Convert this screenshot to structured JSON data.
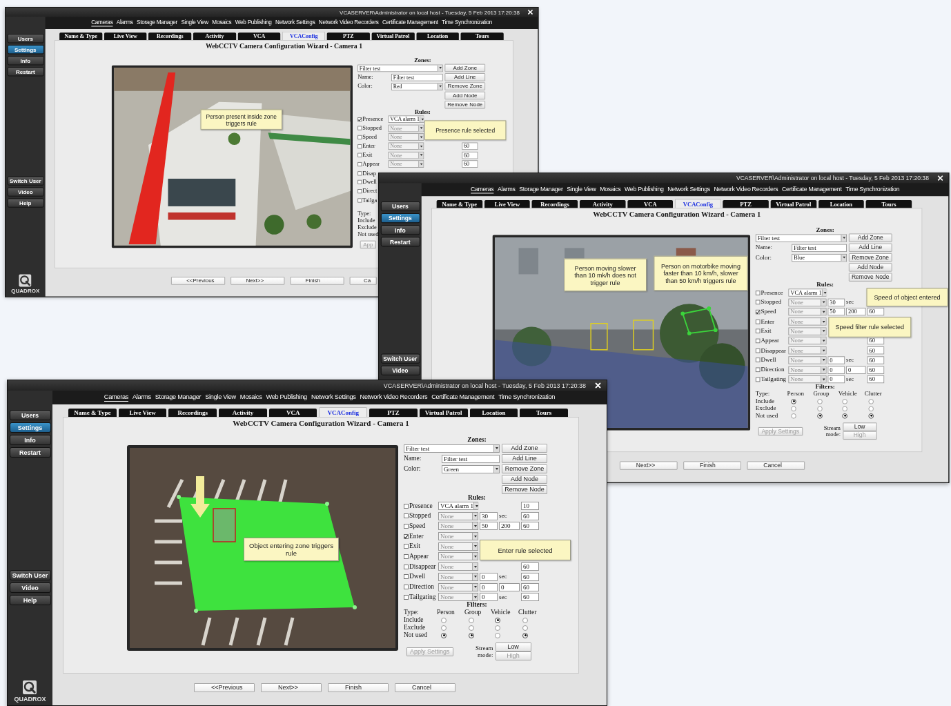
{
  "windows": [
    {
      "title": "VCASERVER\\Administrator on local host  -  Tuesday, 5 Feb 2013 17:20:38",
      "menu": [
        {
          "label": "Cameras",
          "selected": true
        },
        {
          "label": "Alarms",
          "selected": false
        },
        {
          "label": "Storage Manager",
          "selected": false
        },
        {
          "label": "Single View",
          "selected": false
        },
        {
          "label": "Mosaics",
          "selected": false
        },
        {
          "label": "Web Publishing",
          "selected": false
        },
        {
          "label": "Network Settings",
          "selected": false
        },
        {
          "label": "Network Video Recorders",
          "selected": false
        },
        {
          "label": "Certificate Management",
          "selected": false
        },
        {
          "label": "Time Synchronization",
          "selected": false
        }
      ],
      "sidebar": [
        {
          "label": "Users",
          "selected": false
        },
        {
          "label": "Settings",
          "selected": true
        },
        {
          "label": "Info",
          "selected": false
        },
        {
          "label": "Restart",
          "selected": false
        }
      ],
      "sidebar_actions": [
        "Switch User",
        "Video",
        "Help"
      ],
      "logo": "QUADROX",
      "tabs": [
        {
          "label": "Name & Type",
          "selected": false
        },
        {
          "label": "Live View",
          "selected": false
        },
        {
          "label": "Recordings",
          "selected": false
        },
        {
          "label": "Activity",
          "selected": false
        },
        {
          "label": "VCA",
          "selected": false
        },
        {
          "label": "VCAConfig",
          "selected": true
        },
        {
          "label": "PTZ",
          "selected": false
        },
        {
          "label": "Virtual Patrol",
          "selected": false
        },
        {
          "label": "Location",
          "selected": false
        },
        {
          "label": "Tours",
          "selected": false
        }
      ],
      "heading": "WebCCTV Camera Configuration Wizard - Camera 1",
      "zones": {
        "heading": "Zones:",
        "zone": "Filter test",
        "name_label": "Name:",
        "name": "Filter test",
        "color_label": "Color:",
        "color_name": "Red",
        "buttons": [
          "Add Zone",
          "Add Line",
          "Remove Zone",
          "Add Node",
          "Remove Node"
        ]
      },
      "rules": {
        "heading": "Rules:",
        "rows": [
          {
            "label": "Presence",
            "checked": true,
            "select": "VCA alarm 1",
            "select_disabled": false
          },
          {
            "label": "Stopped",
            "checked": false,
            "select": "None",
            "select_disabled": true
          },
          {
            "label": "Speed",
            "checked": false,
            "select": "None",
            "select_disabled": true
          },
          {
            "label": "Enter",
            "checked": false,
            "select": "None",
            "select_disabled": true,
            "field_3": "60"
          },
          {
            "label": "Exit",
            "checked": false,
            "select": "None",
            "select_disabled": true,
            "field_3": "60"
          },
          {
            "label": "Appear",
            "checked": false,
            "select": "None",
            "select_disabled": true,
            "field_3": "60"
          },
          {
            "label": "Disap",
            "checked": false
          },
          {
            "label": "Dwell",
            "checked": false
          },
          {
            "label": "Direct",
            "checked": false
          },
          {
            "label": "Tailga",
            "checked": false
          }
        ]
      },
      "filters": {
        "columns": [
          "Type:"
        ],
        "rows": [
          {
            "label": "Include"
          },
          {
            "label": "Exclude"
          },
          {
            "label": "Not used"
          }
        ]
      },
      "apply": {
        "label": "App",
        "disabled": true
      },
      "nav": [
        "<<Previous",
        "Next>>",
        "Finish",
        "Ca"
      ],
      "callouts": [
        "Person present inside zone triggers rule",
        "Presence rule selected"
      ]
    },
    {
      "title": "VCASERVER\\Administrator on local host  -  Tuesday, 5 Feb 2013 17:20:38",
      "menu": [
        {
          "label": "Cameras",
          "selected": true
        },
        {
          "label": "Alarms",
          "selected": false
        },
        {
          "label": "Storage Manager",
          "selected": false
        },
        {
          "label": "Single View",
          "selected": false
        },
        {
          "label": "Mosaics",
          "selected": false
        },
        {
          "label": "Web Publishing",
          "selected": false
        },
        {
          "label": "Network Settings",
          "selected": false
        },
        {
          "label": "Network Video Recorders",
          "selected": false
        },
        {
          "label": "Certificate Management",
          "selected": false
        },
        {
          "label": "Time Synchronization",
          "selected": false
        }
      ],
      "sidebar": [
        {
          "label": "Users",
          "selected": false
        },
        {
          "label": "Settings",
          "selected": true
        },
        {
          "label": "Info",
          "selected": false
        },
        {
          "label": "Restart",
          "selected": false
        }
      ],
      "sidebar_actions": [
        "Switch User",
        "Video"
      ],
      "tabs": [
        {
          "label": "Name & Type",
          "selected": false
        },
        {
          "label": "Live View",
          "selected": false
        },
        {
          "label": "Recordings",
          "selected": false
        },
        {
          "label": "Activity",
          "selected": false
        },
        {
          "label": "VCA",
          "selected": false
        },
        {
          "label": "VCAConfig",
          "selected": true
        },
        {
          "label": "PTZ",
          "selected": false
        },
        {
          "label": "Virtual Patrol",
          "selected": false
        },
        {
          "label": "Location",
          "selected": false
        },
        {
          "label": "Tours",
          "selected": false
        }
      ],
      "heading": "WebCCTV Camera Configuration Wizard - Camera 1",
      "zones": {
        "heading": "Zones:",
        "zone": "Filter test",
        "name_label": "Name:",
        "name": "Filter test",
        "color_label": "Color:",
        "color_name": "Blue",
        "buttons": [
          "Add Zone",
          "Add Line",
          "Remove Zone",
          "Add Node",
          "Remove Node"
        ]
      },
      "rules": {
        "heading": "Rules:",
        "rows": [
          {
            "label": "Presence",
            "checked": false,
            "select": "VCA alarm 1",
            "select_disabled": false
          },
          {
            "label": "Stopped",
            "checked": false,
            "select": "None",
            "select_disabled": true,
            "field_1": "30",
            "unit": "sec"
          },
          {
            "label": "Speed",
            "checked": true,
            "select": "None",
            "select_disabled": true,
            "field_1": "50",
            "field_2": "200",
            "field_3": "60"
          },
          {
            "label": "Enter",
            "checked": false,
            "select": "None",
            "select_disabled": true
          },
          {
            "label": "Exit",
            "checked": false,
            "select": "None",
            "select_disabled": true
          },
          {
            "label": "Appear",
            "checked": false,
            "select": "None",
            "select_disabled": true,
            "field_3": "60"
          },
          {
            "label": "Disappear",
            "checked": false,
            "select": "None",
            "select_disabled": true,
            "field_3": "60"
          },
          {
            "label": "Dwell",
            "checked": false,
            "select": "None",
            "select_disabled": true,
            "field_1": "0",
            "unit": "sec",
            "field_3": "60"
          },
          {
            "label": "Direction",
            "checked": false,
            "select": "None",
            "select_disabled": true,
            "field_1": "0",
            "field_2": "0",
            "field_3": "60"
          },
          {
            "label": "Tailgating",
            "checked": false,
            "select": "None",
            "select_disabled": true,
            "field_1": "0",
            "unit": "sec",
            "field_3": "60"
          }
        ]
      },
      "filters": {
        "heading": "Filters:",
        "columns": [
          "Type:",
          "Person",
          "Group",
          "Vehicle",
          "Clutter"
        ],
        "rows": [
          {
            "label": "Include",
            "options": [
              {
                "selected": true
              },
              {
                "selected": false
              },
              {
                "selected": false
              },
              {
                "selected": false
              }
            ]
          },
          {
            "label": "Exclude",
            "options": [
              {
                "selected": false
              },
              {
                "selected": false
              },
              {
                "selected": false
              },
              {
                "selected": false
              }
            ]
          },
          {
            "label": "Not used",
            "options": [
              {
                "selected": false
              },
              {
                "selected": true
              },
              {
                "selected": true
              },
              {
                "selected": true
              }
            ]
          }
        ]
      },
      "apply": {
        "label": "Apply Settings",
        "disabled": true
      },
      "stream": {
        "label": "Stream mode:",
        "options": [
          {
            "label": "Low",
            "disabled": false
          },
          {
            "label": "High",
            "disabled": true
          }
        ]
      },
      "nav": [
        "Next>>",
        "Finish",
        "Cancel"
      ],
      "callouts": [
        "Person moving slower than 10 mk/h does not trigger rule",
        "Person on motorbike moving faster than 10 km/h, slower than 50 km/h triggers rule",
        "Speed of object entered",
        "Speed filter rule selected"
      ]
    },
    {
      "title": "VCASERVER\\Administrator on local host  -  Tuesday, 5 Feb 2013 17:20:38",
      "menu": [
        {
          "label": "Cameras",
          "selected": true
        },
        {
          "label": "Alarms",
          "selected": false
        },
        {
          "label": "Storage Manager",
          "selected": false
        },
        {
          "label": "Single View",
          "selected": false
        },
        {
          "label": "Mosaics",
          "selected": false
        },
        {
          "label": "Web Publishing",
          "selected": false
        },
        {
          "label": "Network Settings",
          "selected": false
        },
        {
          "label": "Network Video Recorders",
          "selected": false
        },
        {
          "label": "Certificate Management",
          "selected": false
        },
        {
          "label": "Time Synchronization",
          "selected": false
        }
      ],
      "sidebar": [
        {
          "label": "Users",
          "selected": false
        },
        {
          "label": "Settings",
          "selected": true
        },
        {
          "label": "Info",
          "selected": false
        },
        {
          "label": "Restart",
          "selected": false
        }
      ],
      "sidebar_actions": [
        "Switch User",
        "Video",
        "Help"
      ],
      "logo": "QUADROX",
      "tabs": [
        {
          "label": "Name & Type",
          "selected": false
        },
        {
          "label": "Live View",
          "selected": false
        },
        {
          "label": "Recordings",
          "selected": false
        },
        {
          "label": "Activity",
          "selected": false
        },
        {
          "label": "VCA",
          "selected": false
        },
        {
          "label": "VCAConfig",
          "selected": true
        },
        {
          "label": "PTZ",
          "selected": false
        },
        {
          "label": "Virtual Patrol",
          "selected": false
        },
        {
          "label": "Location",
          "selected": false
        },
        {
          "label": "Tours",
          "selected": false
        }
      ],
      "heading": "WebCCTV Camera Configuration Wizard - Camera 1",
      "zones": {
        "heading": "Zones:",
        "zone": "Filter test",
        "name_label": "Name:",
        "name": "Filter test",
        "color_label": "Color:",
        "color_name": "Green",
        "buttons": [
          "Add Zone",
          "Add Line",
          "Remove Zone",
          "Add Node",
          "Remove Node"
        ]
      },
      "rules": {
        "heading": "Rules:",
        "rows": [
          {
            "label": "Presence",
            "checked": false,
            "select": "VCA alarm 1",
            "select_disabled": false,
            "field_3": "10"
          },
          {
            "label": "Stopped",
            "checked": false,
            "select": "None",
            "select_disabled": true,
            "field_1": "30",
            "unit": "sec",
            "field_3": "60"
          },
          {
            "label": "Speed",
            "checked": false,
            "select": "None",
            "select_disabled": true,
            "field_1": "50",
            "field_2": "200",
            "field_3": "60"
          },
          {
            "label": "Enter",
            "checked": true,
            "select": "None",
            "select_disabled": true
          },
          {
            "label": "Exit",
            "checked": false,
            "select": "None",
            "select_disabled": true
          },
          {
            "label": "Appear",
            "checked": false,
            "select": "None",
            "select_disabled": true
          },
          {
            "label": "Disappear",
            "checked": false,
            "select": "None",
            "select_disabled": true,
            "field_3": "60"
          },
          {
            "label": "Dwell",
            "checked": false,
            "select": "None",
            "select_disabled": true,
            "field_1": "0",
            "unit": "sec",
            "field_3": "60"
          },
          {
            "label": "Direction",
            "checked": false,
            "select": "None",
            "select_disabled": true,
            "field_1": "0",
            "field_2": "0",
            "field_3": "60"
          },
          {
            "label": "Tailgating",
            "checked": false,
            "select": "None",
            "select_disabled": true,
            "field_1": "0",
            "unit": "sec",
            "field_3": "60"
          }
        ]
      },
      "filters": {
        "heading": "Filters:",
        "columns": [
          "Type:",
          "Person",
          "Group",
          "Vehicle",
          "Clutter"
        ],
        "rows": [
          {
            "label": "Include",
            "options": [
              {
                "selected": false
              },
              {
                "selected": false
              },
              {
                "selected": true
              },
              {
                "selected": false
              }
            ]
          },
          {
            "label": "Exclude",
            "options": [
              {
                "selected": false
              },
              {
                "selected": false
              },
              {
                "selected": false
              },
              {
                "selected": false
              }
            ]
          },
          {
            "label": "Not used",
            "options": [
              {
                "selected": true
              },
              {
                "selected": true
              },
              {
                "selected": false
              },
              {
                "selected": true
              }
            ]
          }
        ]
      },
      "apply": {
        "label": "Apply Settings",
        "disabled": true
      },
      "stream": {
        "label": "Stream mode:",
        "options": [
          {
            "label": "Low",
            "disabled": false
          },
          {
            "label": "High",
            "disabled": true
          }
        ]
      },
      "nav": [
        "<<Previous",
        "Next>>",
        "Finish",
        "Cancel"
      ],
      "callouts": [
        "Object entering zone triggers rule",
        "Enter rule selected"
      ]
    }
  ]
}
